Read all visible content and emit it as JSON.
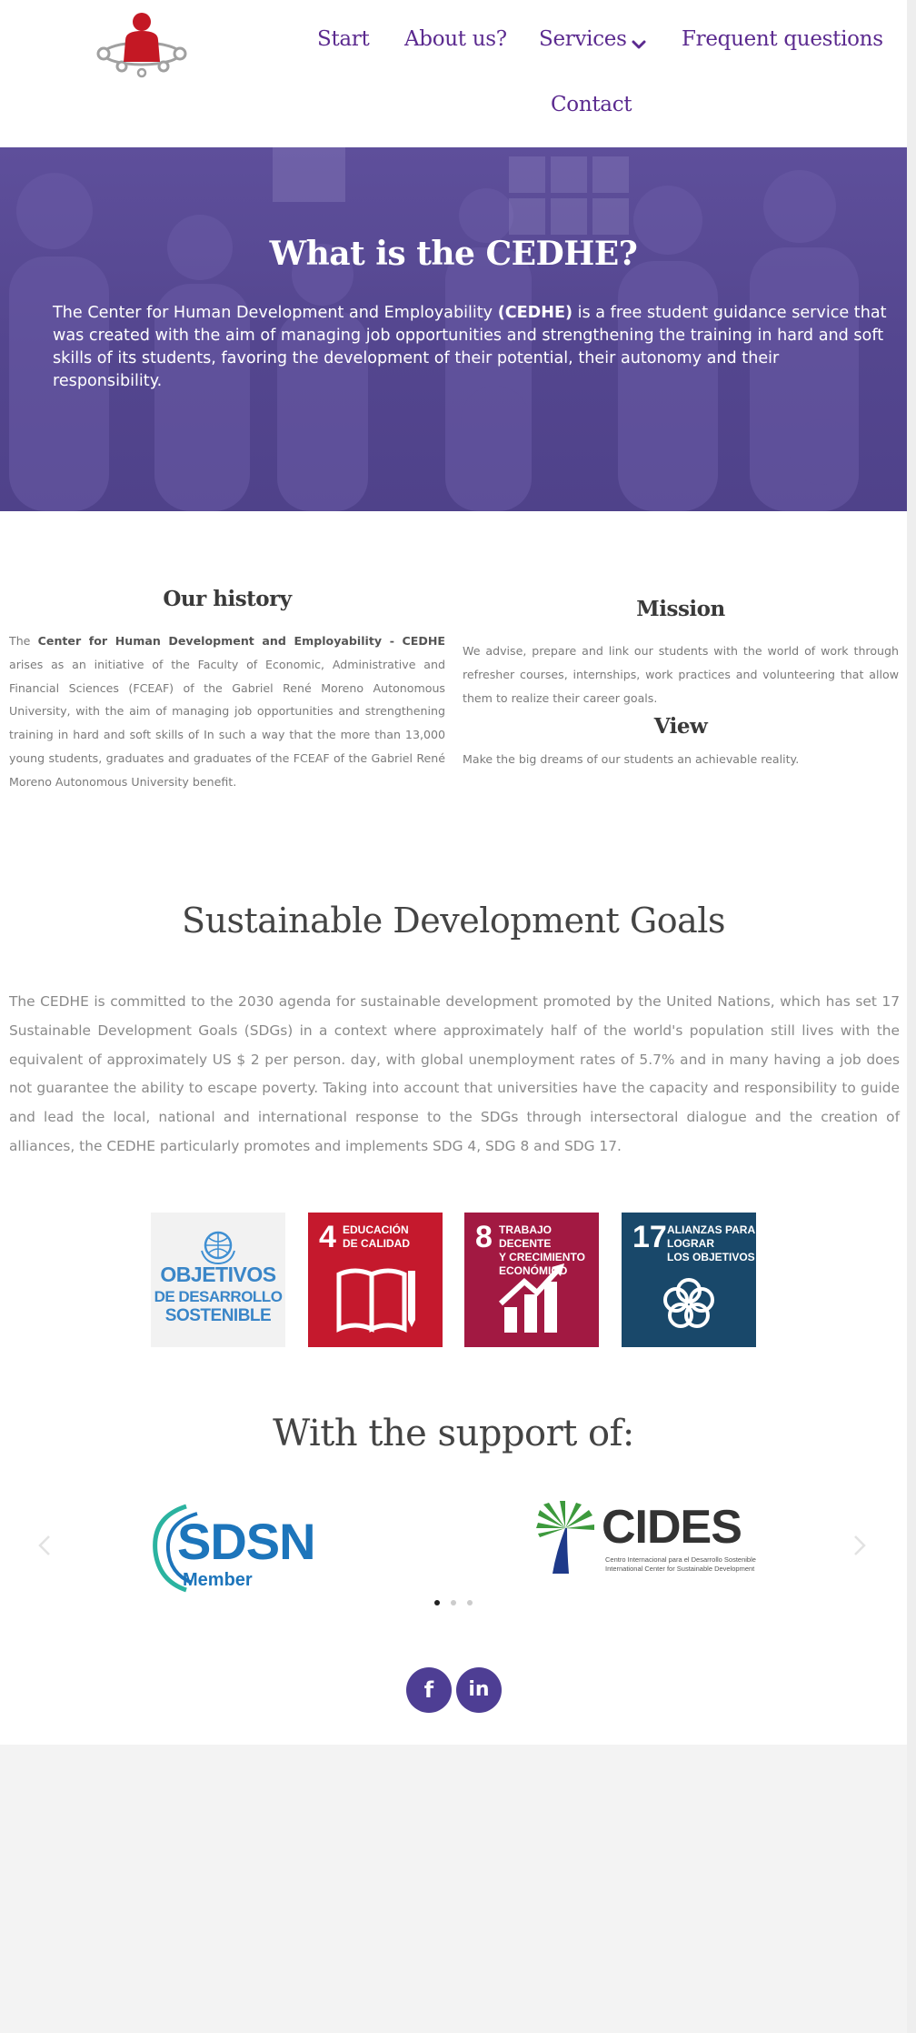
{
  "nav": {
    "items": [
      "Start",
      "About us?",
      "Services",
      "Frequent questions",
      "Contact"
    ]
  },
  "hero": {
    "title": "What is the CEDHE?",
    "text_before": "The Center for Human Development and Employability ",
    "text_bold": "(CEDHE)",
    "text_after": " is a free student guidance service that was created with the aim of managing job opportunities and strengthening the training in hard and soft skills of its students, favoring the development of their potential, their autonomy and their responsibility."
  },
  "history": {
    "title": "Our history",
    "text_before": "The ",
    "text_bold": "Center for Human Development and Employability - CEDHE",
    "text_after": " arises as an initiative of the Faculty of Economic, Administrative and Financial Sciences (FCEAF) of the Gabriel René Moreno Autonomous University, with the aim of managing job opportunities and strengthening training in hard and soft skills of In such a way that the more than 13,000 young students, graduates and graduates of the FCEAF of the Gabriel René Moreno Autonomous University benefit."
  },
  "mission": {
    "title": "Mission",
    "text": "We advise, prepare and link our students with the world of work through refresher courses, internships, work practices and volunteering that allow them to realize their career goals."
  },
  "view": {
    "title": "View",
    "text": "Make the big dreams of our students an achievable reality."
  },
  "sdg": {
    "title": "Sustainable Development Goals",
    "text": "The CEDHE is committed to the 2030 agenda for sustainable development promoted by the United Nations, which has set 17 Sustainable Development Goals (SDGs) in a context where approximately half of the world's population still lives with the equivalent of approximately US $ 2 per person. day, with global unemployment rates of 5.7% and in many having a job does not guarantee the ability to escape poverty. Taking into account that universities have the capacity and responsibility to guide and lead the local, national and international response to the SDGs through intersectoral dialogue and the creation of alliances, the CEDHE particularly promotes and implements SDG 4, SDG 8 and SDG 17.",
    "tiles": [
      {
        "lines": [
          "OBJETIVOS",
          "DE DESARROLLO",
          "SOSTENIBLE"
        ],
        "color": "#f2f2f2",
        "icon": "un-emblem-icon"
      },
      {
        "number": "4",
        "label": "EDUCACIÓN\nDE CALIDAD",
        "color": "#c5192d",
        "icon": "book-icon"
      },
      {
        "number": "8",
        "label": "TRABAJO DECENTE\nY CRECIMIENTO\nECONÓMICO",
        "color": "#a21942",
        "icon": "growth-chart-icon"
      },
      {
        "number": "17",
        "label": "ALIANZAS PARA\nLOGRAR\nLOS OBJETIVOS",
        "color": "#19486a",
        "icon": "flower-icon"
      }
    ]
  },
  "support": {
    "title": "With the support of:",
    "logos": [
      {
        "name": "SDSN",
        "subtitle": "Member",
        "color": "#1d75bb"
      },
      {
        "name": "CIDES",
        "line1": "Centro Internacional para el Desarrollo Sostenible",
        "line2": "International Center for Sustainable Development",
        "color": "#333333"
      }
    ]
  },
  "social": {
    "facebook": "f",
    "linkedin": "in"
  },
  "colors": {
    "nav": "#5b2a8f",
    "hero_overlay": "#54468f",
    "social": "#4e3e94"
  }
}
